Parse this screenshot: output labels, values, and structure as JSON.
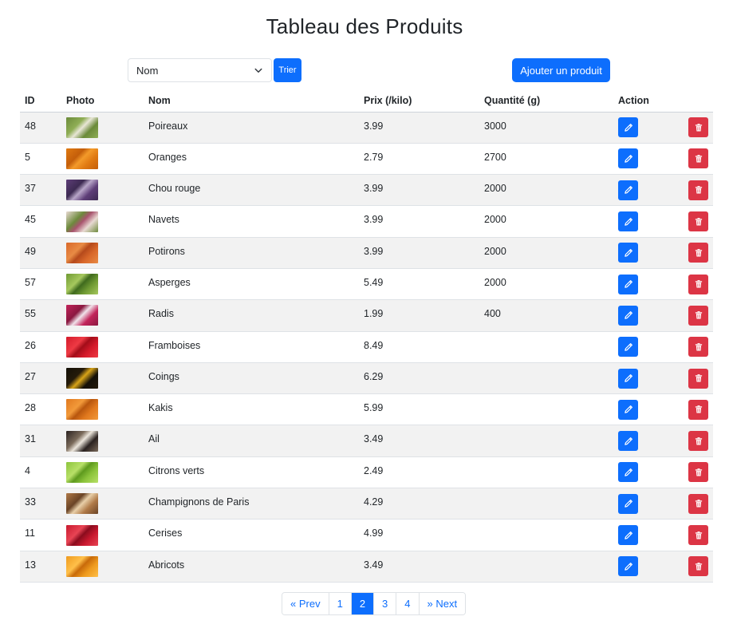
{
  "page": {
    "title": "Tableau des Produits"
  },
  "controls": {
    "sort_select_value": "Nom",
    "sort_button_label": "Trier",
    "add_button_label": "Ajouter un produit"
  },
  "table": {
    "headers": {
      "id": "ID",
      "photo": "Photo",
      "nom": "Nom",
      "prix": "Prix (/kilo)",
      "quantite": "Quantité (g)",
      "action": "Action"
    },
    "rows": [
      {
        "id": "48",
        "nom": "Poireaux",
        "prix": "3.99",
        "quantite": "3000",
        "photo_colors": [
          "#6b8a3a",
          "#e8e6d6",
          "#8fae55"
        ]
      },
      {
        "id": "5",
        "nom": "Oranges",
        "prix": "2.79",
        "quantite": "2700",
        "photo_colors": [
          "#e07a12",
          "#f39a2a",
          "#c45e0a"
        ]
      },
      {
        "id": "37",
        "nom": "Chou rouge",
        "prix": "3.99",
        "quantite": "2000",
        "photo_colors": [
          "#5e3e78",
          "#b8a6c8",
          "#3d2a52"
        ]
      },
      {
        "id": "45",
        "nom": "Navets",
        "prix": "3.99",
        "quantite": "2000",
        "photo_colors": [
          "#e8d9d2",
          "#a8546e",
          "#6d8a3c"
        ]
      },
      {
        "id": "49",
        "nom": "Potirons",
        "prix": "3.99",
        "quantite": "2000",
        "photo_colors": [
          "#d9682a",
          "#b54a1c",
          "#e88b45"
        ]
      },
      {
        "id": "57",
        "nom": "Asperges",
        "prix": "5.49",
        "quantite": "2000",
        "photo_colors": [
          "#6f9a33",
          "#3f6a1e",
          "#a6c85e"
        ]
      },
      {
        "id": "55",
        "nom": "Radis",
        "prix": "1.99",
        "quantite": "400",
        "photo_colors": [
          "#c2245a",
          "#f0e2ea",
          "#8a1840"
        ]
      },
      {
        "id": "26",
        "nom": "Framboises",
        "prix": "8.49",
        "quantite": "",
        "photo_colors": [
          "#d41a2a",
          "#a30d1a",
          "#ee3a44"
        ]
      },
      {
        "id": "27",
        "nom": "Coings",
        "prix": "6.29",
        "quantite": "",
        "photo_colors": [
          "#141008",
          "#d8a418",
          "#241a0a"
        ]
      },
      {
        "id": "28",
        "nom": "Kakis",
        "prix": "5.99",
        "quantite": "",
        "photo_colors": [
          "#e0781e",
          "#b8560e",
          "#f29a3a"
        ]
      },
      {
        "id": "31",
        "nom": "Ail",
        "prix": "3.49",
        "quantite": "",
        "photo_colors": [
          "#2a2220",
          "#ece6dc",
          "#7a6a5a"
        ]
      },
      {
        "id": "4",
        "nom": "Citrons verts",
        "prix": "2.49",
        "quantite": "",
        "photo_colors": [
          "#8cc43c",
          "#5e9a1e",
          "#b8e068"
        ]
      },
      {
        "id": "33",
        "nom": "Champignons de Paris",
        "prix": "4.29",
        "quantite": "",
        "photo_colors": [
          "#b07a48",
          "#e8cfa8",
          "#6a4426"
        ]
      },
      {
        "id": "11",
        "nom": "Cerises",
        "prix": "4.99",
        "quantite": "",
        "photo_colors": [
          "#c8182e",
          "#8a0c1e",
          "#e84454"
        ]
      },
      {
        "id": "13",
        "nom": "Abricots",
        "prix": "3.49",
        "quantite": "",
        "photo_colors": [
          "#ee9a1e",
          "#c86a0a",
          "#ffc04a"
        ]
      }
    ]
  },
  "pagination": {
    "prev_label": "« Prev",
    "pages": [
      "1",
      "2",
      "3",
      "4"
    ],
    "active_page": "2",
    "next_label": "» Next"
  },
  "colors": {
    "primary": "#0d6efd",
    "danger": "#dc3545",
    "stripe": "#f2f2f2"
  },
  "icons": {
    "edit": "pencil-icon",
    "delete": "trash-icon",
    "select": "chevron-down-icon"
  }
}
